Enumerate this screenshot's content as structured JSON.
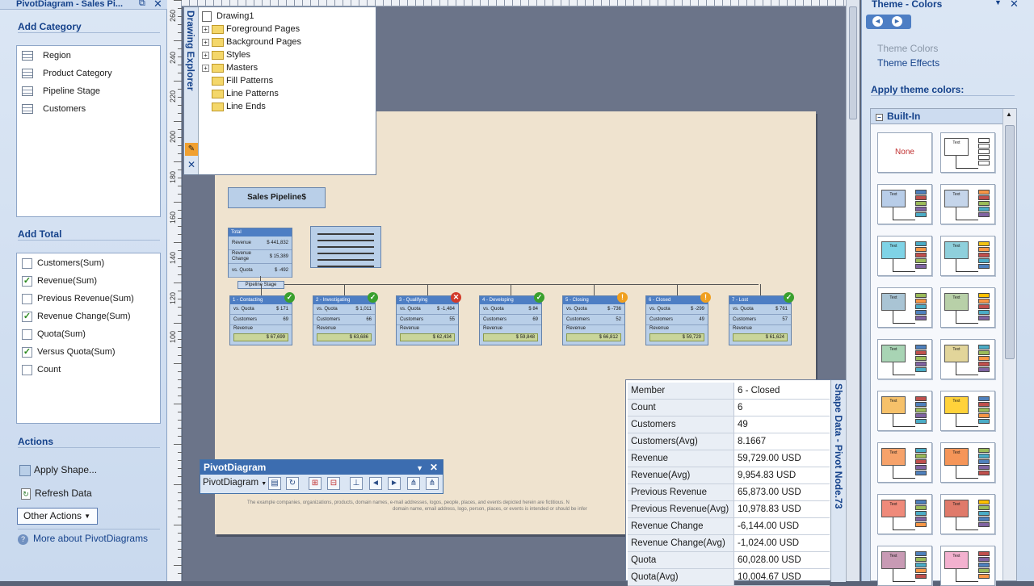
{
  "left_pane": {
    "title": "PivotDiagram - Sales Pi...",
    "add_category": {
      "heading": "Add Category",
      "items": [
        "Region",
        "Product Category",
        "Pipeline Stage",
        "Customers"
      ]
    },
    "add_total": {
      "heading": "Add Total",
      "items": [
        {
          "label": "Customers(Sum)",
          "checked": false
        },
        {
          "label": "Revenue(Sum)",
          "checked": true
        },
        {
          "label": "Previous Revenue(Sum)",
          "checked": false
        },
        {
          "label": "Revenue Change(Sum)",
          "checked": true
        },
        {
          "label": "Quota(Sum)",
          "checked": false
        },
        {
          "label": "Versus Quota(Sum)",
          "checked": true
        },
        {
          "label": "Count",
          "checked": false
        }
      ]
    },
    "actions": {
      "heading": "Actions",
      "apply_shape": "Apply Shape...",
      "refresh": "Refresh Data",
      "other_actions": "Other Actions",
      "more_about": "More about PivotDiagrams"
    }
  },
  "ruler_labels": [
    "260",
    "240",
    "220",
    "200",
    "180",
    "160",
    "140",
    "120",
    "100"
  ],
  "drawing_explorer": {
    "title": "Drawing Explorer",
    "root": "Drawing1",
    "items": [
      {
        "label": "Foreground Pages",
        "expandable": true
      },
      {
        "label": "Background Pages",
        "expandable": true
      },
      {
        "label": "Styles",
        "expandable": true
      },
      {
        "label": "Masters",
        "expandable": true
      },
      {
        "label": "Fill Patterns",
        "expandable": false
      },
      {
        "label": "Line Patterns",
        "expandable": false
      },
      {
        "label": "Line Ends",
        "expandable": false
      }
    ]
  },
  "diagram": {
    "title": "Sales Pipeline$",
    "total": {
      "header": "Total",
      "rows": [
        {
          "k": "Revenue",
          "v": "$ 441,832"
        },
        {
          "k": "Revenue Change",
          "v": "$ 15,389"
        },
        {
          "k": "vs. Quota",
          "v": "$ -492"
        }
      ]
    },
    "stage_label": "Pipeline Stage",
    "nodes": [
      {
        "header": "1 - Contacting",
        "quota": "$ 171",
        "customers": "69",
        "revenue": "$ 67,699",
        "status": "ok"
      },
      {
        "header": "2 - Investigating",
        "quota": "$ 1,011",
        "customers": "66",
        "revenue": "$ 63,686",
        "status": "ok"
      },
      {
        "header": "3 - Qualifying",
        "quota": "$ -1,484",
        "customers": "55",
        "revenue": "$ 62,434",
        "status": "bad"
      },
      {
        "header": "4 - Developing",
        "quota": "$ 84",
        "customers": "69",
        "revenue": "$ 59,848",
        "status": "ok"
      },
      {
        "header": "5 - Closing",
        "quota": "$ -736",
        "customers": "52",
        "revenue": "$ 66,812",
        "status": "warn"
      },
      {
        "header": "6 - Closed",
        "quota": "$ -299",
        "customers": "49",
        "revenue": "$ 59,729",
        "status": "warn"
      },
      {
        "header": "7 - Lost",
        "quota": "$ 761",
        "customers": "57",
        "revenue": "$ 61,624",
        "status": "ok"
      }
    ],
    "labels": {
      "quota": "vs. Quota",
      "customers": "Customers",
      "revenue": "Revenue"
    },
    "disclaimer_1": "The example companies, organizations, products, domain names, e-mail addresses, logos, people, places, and events depicted herein are fictitious. N",
    "disclaimer_2": "domain name, email address, logo, person, places, or events is intended or should be infer"
  },
  "pivot_toolbar": {
    "title": "PivotDiagram",
    "menu": "PivotDiagram"
  },
  "shape_data": {
    "title": "Shape Data - Pivot Node.73",
    "rows": [
      {
        "k": "Member",
        "v": "6 - Closed"
      },
      {
        "k": "Count",
        "v": "6"
      },
      {
        "k": "Customers",
        "v": "49"
      },
      {
        "k": "Customers(Avg)",
        "v": "8.1667"
      },
      {
        "k": "Revenue",
        "v": "59,729.00 USD"
      },
      {
        "k": "Revenue(Avg)",
        "v": "9,954.83 USD"
      },
      {
        "k": "Previous Revenue",
        "v": "65,873.00 USD"
      },
      {
        "k": "Previous Revenue(Avg)",
        "v": "10,978.83 USD"
      },
      {
        "k": "Revenue Change",
        "v": "-6,144.00 USD"
      },
      {
        "k": "Revenue Change(Avg)",
        "v": "-1,024.00 USD"
      },
      {
        "k": "Quota",
        "v": "60,028.00 USD"
      },
      {
        "k": "Quota(Avg)",
        "v": "10,004.67 USD"
      }
    ]
  },
  "right_pane": {
    "title": "Theme - Colors",
    "theme_colors": "Theme Colors",
    "theme_effects": "Theme Effects",
    "apply_heading": "Apply theme colors:",
    "group": "Built-In",
    "none_label": "None",
    "swatch_text": "Text",
    "swatches": [
      {
        "box": "#ffffff",
        "bars": [
          "#ffffff",
          "#ffffff",
          "#ffffff",
          "#ffffff",
          "#ffffff"
        ]
      },
      {
        "box": "#b8cde8",
        "bars": [
          "#4f81bd",
          "#c0504d",
          "#9bbb59",
          "#8064a2",
          "#4bacc6"
        ]
      },
      {
        "box": "#c5d5ea",
        "bars": [
          "#f79646",
          "#c0504d",
          "#9bbb59",
          "#4bacc6",
          "#8064a2"
        ]
      },
      {
        "box": "#7fd3e6",
        "bars": [
          "#4bacc6",
          "#f79646",
          "#c0504d",
          "#9bbb59",
          "#8064a2"
        ]
      },
      {
        "box": "#8fd0dc",
        "bars": [
          "#f2c314",
          "#f79646",
          "#c0504d",
          "#4bacc6",
          "#4f81bd"
        ]
      },
      {
        "box": "#a9c4d4",
        "bars": [
          "#9bbb59",
          "#f79646",
          "#4bacc6",
          "#4f81bd",
          "#8064a2"
        ]
      },
      {
        "box": "#b8d0a8",
        "bars": [
          "#ffc000",
          "#f79646",
          "#c0504d",
          "#4bacc6",
          "#8064a2"
        ]
      },
      {
        "box": "#a8d4b4",
        "bars": [
          "#4f81bd",
          "#c0504d",
          "#9bbb59",
          "#8064a2",
          "#4bacc6"
        ]
      },
      {
        "box": "#e2d59a",
        "bars": [
          "#4bacc6",
          "#9bbb59",
          "#f79646",
          "#c0504d",
          "#8064a2"
        ]
      },
      {
        "box": "#f6c16a",
        "bars": [
          "#c0504d",
          "#4f81bd",
          "#9bbb59",
          "#8064a2",
          "#4bacc6"
        ]
      },
      {
        "box": "#ffd23a",
        "bars": [
          "#4f81bd",
          "#c0504d",
          "#9bbb59",
          "#f79646",
          "#4bacc6"
        ]
      },
      {
        "box": "#f6a26a",
        "bars": [
          "#4bacc6",
          "#9bbb59",
          "#c0504d",
          "#8064a2",
          "#4f81bd"
        ]
      },
      {
        "box": "#f59558",
        "bars": [
          "#9bbb59",
          "#4bacc6",
          "#4f81bd",
          "#8064a2",
          "#c0504d"
        ]
      },
      {
        "box": "#ef8a7a",
        "bars": [
          "#4f81bd",
          "#9bbb59",
          "#4bacc6",
          "#8064a2",
          "#f79646"
        ]
      },
      {
        "box": "#e07a6a",
        "bars": [
          "#ffc000",
          "#9bbb59",
          "#4bacc6",
          "#4f81bd",
          "#8064a2"
        ]
      },
      {
        "box": "#c89ab4",
        "bars": [
          "#4f81bd",
          "#9bbb59",
          "#4bacc6",
          "#f79646",
          "#c0504d"
        ]
      },
      {
        "box": "#f3b1cf",
        "bars": [
          "#c0504d",
          "#8064a2",
          "#4f81bd",
          "#9bbb59",
          "#f79646"
        ]
      }
    ]
  }
}
